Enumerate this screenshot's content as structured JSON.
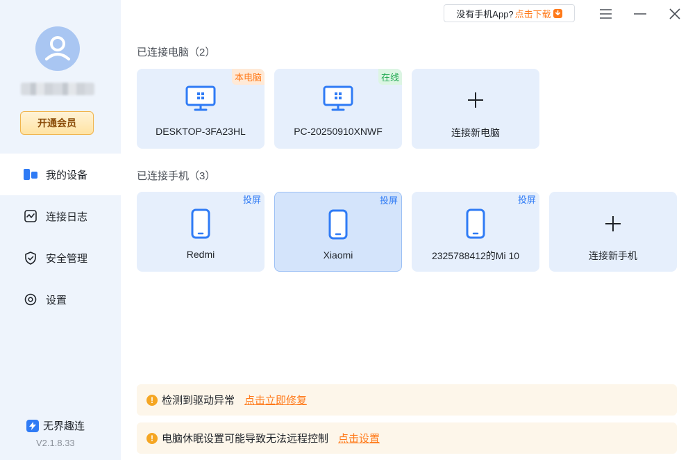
{
  "sidebar": {
    "vip_label": "开通会员",
    "nav": [
      {
        "label": "我的设备"
      },
      {
        "label": "连接日志"
      },
      {
        "label": "安全管理"
      },
      {
        "label": "设置"
      }
    ],
    "brand": "无界趣连",
    "version": "V2.1.8.33"
  },
  "topbar": {
    "tip_text": "没有手机App?",
    "tip_link": "点击下载"
  },
  "computers": {
    "title": "已连接电脑（2）",
    "items": [
      {
        "name": "DESKTOP-3FA23HL",
        "tag": "本电脑"
      },
      {
        "name": "PC-20250910XNWF",
        "tag": "在线"
      },
      {
        "name": "连接新电脑"
      }
    ]
  },
  "phones": {
    "title": "已连接手机（3）",
    "items": [
      {
        "name": "Redmi",
        "tag": "投屏"
      },
      {
        "name": "Xiaomi",
        "tag": "投屏"
      },
      {
        "name": "2325788412的Mi 10",
        "tag": "投屏"
      },
      {
        "name": "连接新手机"
      }
    ]
  },
  "alerts": [
    {
      "text": "检测到驱动异常",
      "link": "点击立即修复"
    },
    {
      "text": "电脑休眠设置可能导致无法远程控制",
      "link": "点击设置"
    }
  ],
  "colors": {
    "accent": "#2f7bf5",
    "sidebar_bg": "#eef4fc",
    "card_bg": "#e6effc",
    "warning": "#ff7a1a"
  }
}
